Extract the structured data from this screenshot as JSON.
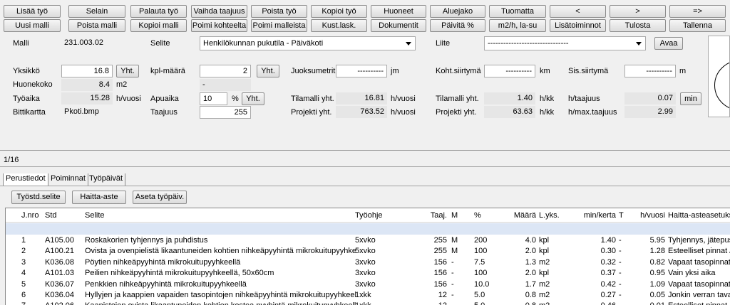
{
  "toolbar": {
    "row1": [
      "Lisää työ",
      "Selain",
      "Palauta työ",
      "Vaihda taajuus",
      "Poista työ",
      "Kopioi työ",
      "Huoneet",
      "Aluejako",
      "Tuomatta",
      "<",
      ">",
      "=>"
    ],
    "row2": [
      "Uusi malli",
      "Poista malli",
      "Kopioi malli",
      "Poimi kohteelta",
      "Poimi malleista",
      "Kust.lask.",
      "Dokumentit",
      "Päivitä %",
      "m2/h, la-su",
      "Lisätoiminnot",
      "Tulosta",
      "Tallenna"
    ]
  },
  "form": {
    "malli_label": "Malli",
    "malli_value": "231.003.02",
    "selite_label": "Selite",
    "selite_value": "Henkilökunnan pukutila - Päiväkoti",
    "liite_label": "Liite",
    "liite_value": "-------------------------------",
    "avaa": "Avaa",
    "yksikko_label": "Yksikkö",
    "yksikko_value": "16.8",
    "yht": "Yht.",
    "kpl_label": "kpl-määrä",
    "kpl_value": "2",
    "juoksumetrit_label": "Juoksumetrit",
    "juoksumetrit_value": "----------",
    "jm": "jm",
    "koht_label": "Koht.siirtymä",
    "koht_value": "----------",
    "km": "km",
    "sis_label": "Sis.siirtymä",
    "sis_value": "----------",
    "m": "m",
    "huonekoko_label": "Huonekoko",
    "huonekoko_value": "8.4",
    "m2": "m2",
    "dash": "-",
    "tyoaika_label": "Työaika",
    "tyoaika_value": "15.28",
    "h_vuosi": "h/vuosi",
    "apuaika_label": "Apuaika",
    "apuaika_value": "10",
    "pct": "%",
    "tilamalli_label": "Tilamalli yht.",
    "tilamalli_value": "16.81",
    "tilamalli2_label": "Tilamalli yht.",
    "tilamalli2_value": "1.40",
    "h_kk": "h/kk",
    "h_taajuus_label": "h/taajuus",
    "h_taajuus_value": "0.07",
    "min": "min",
    "bittikartta_label": "Bittikartta",
    "bittikartta_value": "Pkoti.bmp",
    "taajuus_label": "Taajuus",
    "taajuus_value": "255",
    "projekti_label": "Projekti yht.",
    "projekti_value": "763.52",
    "projekti2_label": "Projekti yht.",
    "projekti2_value": "63.63",
    "hmax_label": "h/max.taajuus",
    "hmax_value": "2.99"
  },
  "record_nav": "1/16",
  "tabs": [
    "Perustiedot",
    "Poiminnat",
    "Työpäivät"
  ],
  "subbuttons": [
    "Työstd.selite",
    "Haitta-aste",
    "Aseta työpäiv."
  ],
  "table": {
    "headers": [
      "J.nro",
      "Std",
      "Selite",
      "Työohje",
      "Taaj.",
      "M",
      "%",
      "Määrä",
      "L.yks.",
      "min/kerta",
      "T",
      "h/vuosi",
      "Haitta-asteasetuks"
    ],
    "rows": [
      [
        "1",
        "A105.00",
        "Roskakorien tyhjennys ja puhdistus",
        "5xvko",
        "255",
        "M",
        "200",
        "4.0",
        "kpl",
        "1.40",
        "-",
        "5.95",
        "Tyhjennys, jätepus"
      ],
      [
        "2",
        "A100.21",
        "Ovista ja ovenpielistä likaantuneiden kohtien nihkeäpyyhintä mikrokuitupyyhkee...",
        "5xvko",
        "255",
        "M",
        "100",
        "2.0",
        "kpl",
        "0.30",
        "-",
        "1.28",
        "Esteelliset pinnat / T"
      ],
      [
        "3",
        "K036.08",
        "Pöytien nihkeäpyyhintä mikrokuitupyyhkeellä",
        "3xvko",
        "156",
        "-",
        "7.5",
        "1.3",
        "m2",
        "0.32",
        "-",
        "0.82",
        "Vapaat tasopinnat"
      ],
      [
        "4",
        "A101.03",
        "Peilien nihkeäpyyhintä mikrokuitupyyhkeellä, 50x60cm",
        "3xvko",
        "156",
        "-",
        "100",
        "2.0",
        "kpl",
        "0.37",
        "-",
        "0.95",
        "Vain yksi aika"
      ],
      [
        "5",
        "K036.07",
        "Penkkien nihkeäpyyhintä mikrokuitupyyhkeellä",
        "3xvko",
        "156",
        "-",
        "10.0",
        "1.7",
        "m2",
        "0.42",
        "-",
        "1.09",
        "Vapaat tasopinnat"
      ],
      [
        "6",
        "K036.04",
        "Hyllyjen ja kaappien vapaiden tasopintojen nihkeäpyyhintä mikrokuitupyyhkeellä",
        "1xkk",
        "12",
        "-",
        "5.0",
        "0.8",
        "m2",
        "0.27",
        "-",
        "0.05",
        "Jonkin verran tavar"
      ],
      [
        "7",
        "A102.06",
        "Kaapistojen ovista likaantuneiden kohtien kostea pyyhintä mikrokuitupyyhkeellä",
        "1xkk",
        "12",
        "-",
        "5.0",
        "0.8",
        "m2",
        "0.46",
        "-",
        "0.01",
        "Esteelliset pinnat"
      ]
    ]
  }
}
